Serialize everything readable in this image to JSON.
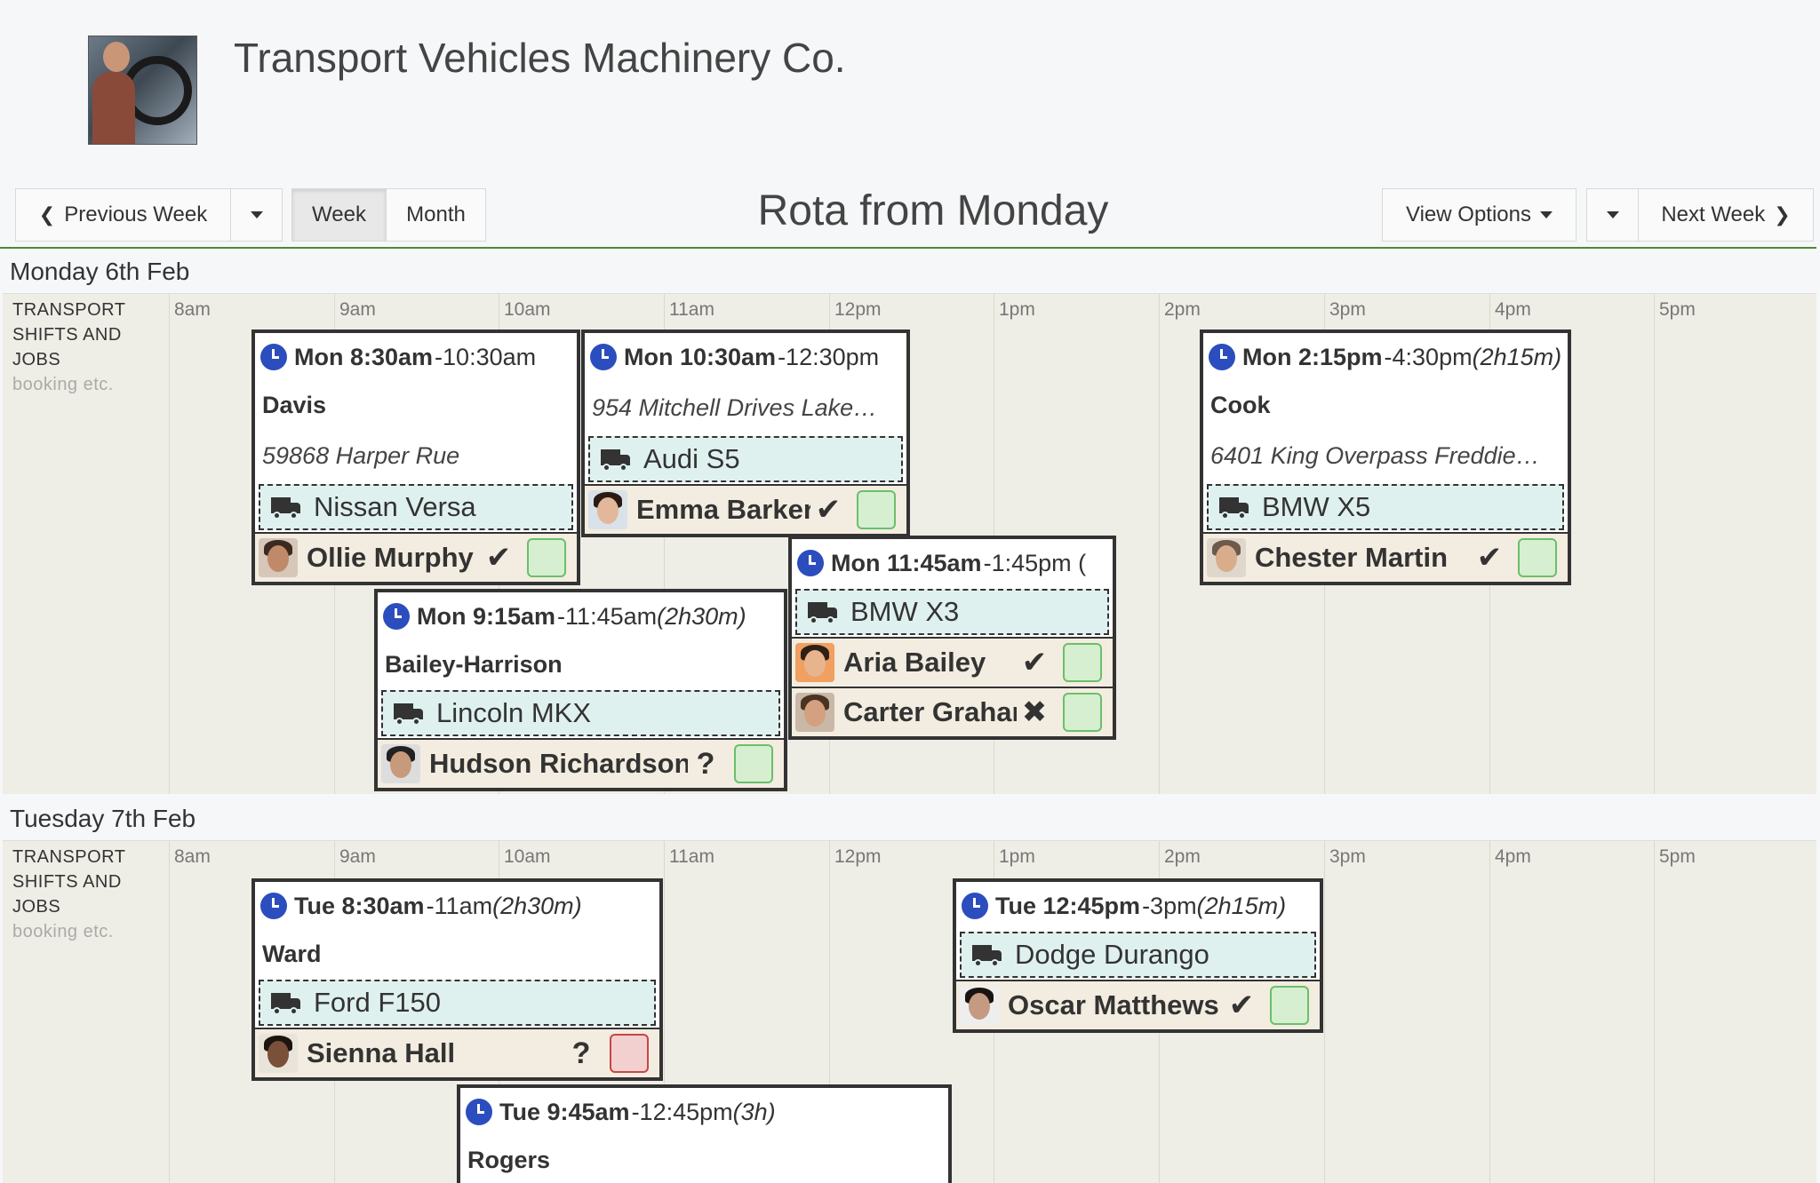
{
  "company": {
    "name": "Transport Vehicles Machinery Co."
  },
  "toolbar": {
    "prev_week": "Previous Week",
    "week": "Week",
    "month": "Month",
    "title": "Rota from Monday",
    "view_options": "View Options",
    "next_week": "Next Week"
  },
  "hours": [
    "8am",
    "9am",
    "10am",
    "11am",
    "12pm",
    "1pm",
    "2pm",
    "3pm",
    "4pm",
    "5pm"
  ],
  "row_label": {
    "title": "TRANSPORT SHIFTS AND JOBS",
    "sub": "booking etc."
  },
  "days": [
    {
      "label": "Monday 6th Feb",
      "jobs": [
        {
          "start": "Mon 8:30am",
          "rest": "-10:30am",
          "dur": "",
          "name": "Davis",
          "address": "59868 Harper Rue",
          "vehicle": "Nissan Versa",
          "staff": [
            {
              "name": "Ollie Murphy",
              "status": "✔",
              "box": "green"
            }
          ]
        },
        {
          "start": "Mon 10:30am",
          "rest": "-12:30pm",
          "dur": "",
          "name": "",
          "address": "954 Mitchell Drives Lake…",
          "vehicle": "Audi S5",
          "staff": [
            {
              "name": "Emma Barker",
              "status": "✔",
              "box": "green"
            }
          ]
        },
        {
          "start": "Mon 2:15pm",
          "rest": "-4:30pm ",
          "dur": "(2h15m)",
          "name": "Cook",
          "address": "6401 King Overpass Freddie…",
          "vehicle": "BMW X5",
          "staff": [
            {
              "name": "Chester Martin",
              "status": "✔",
              "box": "green"
            }
          ]
        },
        {
          "start": "Mon 11:45am",
          "rest": "-1:45pm (",
          "dur": "",
          "name": "",
          "address": "",
          "vehicle": "BMW X3",
          "staff": [
            {
              "name": "Aria Bailey",
              "status": "✔",
              "box": "green"
            },
            {
              "name": "Carter Graham",
              "status": "✖",
              "box": "green"
            }
          ]
        },
        {
          "start": "Mon 9:15am",
          "rest": "-11:45am ",
          "dur": "(2h30m)",
          "name": "Bailey-Harrison",
          "address": "",
          "vehicle": "Lincoln MKX",
          "staff": [
            {
              "name": "Hudson Richardson",
              "status": "?",
              "box": "green"
            }
          ]
        }
      ]
    },
    {
      "label": "Tuesday 7th Feb",
      "jobs": [
        {
          "start": "Tue 8:30am",
          "rest": "-11am ",
          "dur": "(2h30m)",
          "name": "Ward",
          "address": "",
          "vehicle": "Ford F150",
          "staff": [
            {
              "name": "Sienna Hall",
              "status": "?",
              "box": "red"
            }
          ]
        },
        {
          "start": "Tue 12:45pm",
          "rest": "-3pm ",
          "dur": "(2h15m)",
          "name": "",
          "address": "",
          "vehicle": "Dodge Durango",
          "staff": [
            {
              "name": "Oscar Matthews",
              "status": "✔",
              "box": "green"
            }
          ]
        },
        {
          "start": "Tue 9:45am",
          "rest": "-12:45pm ",
          "dur": "(3h)",
          "name": "Rogers",
          "address": "",
          "vehicle": "",
          "staff": []
        }
      ]
    }
  ]
}
